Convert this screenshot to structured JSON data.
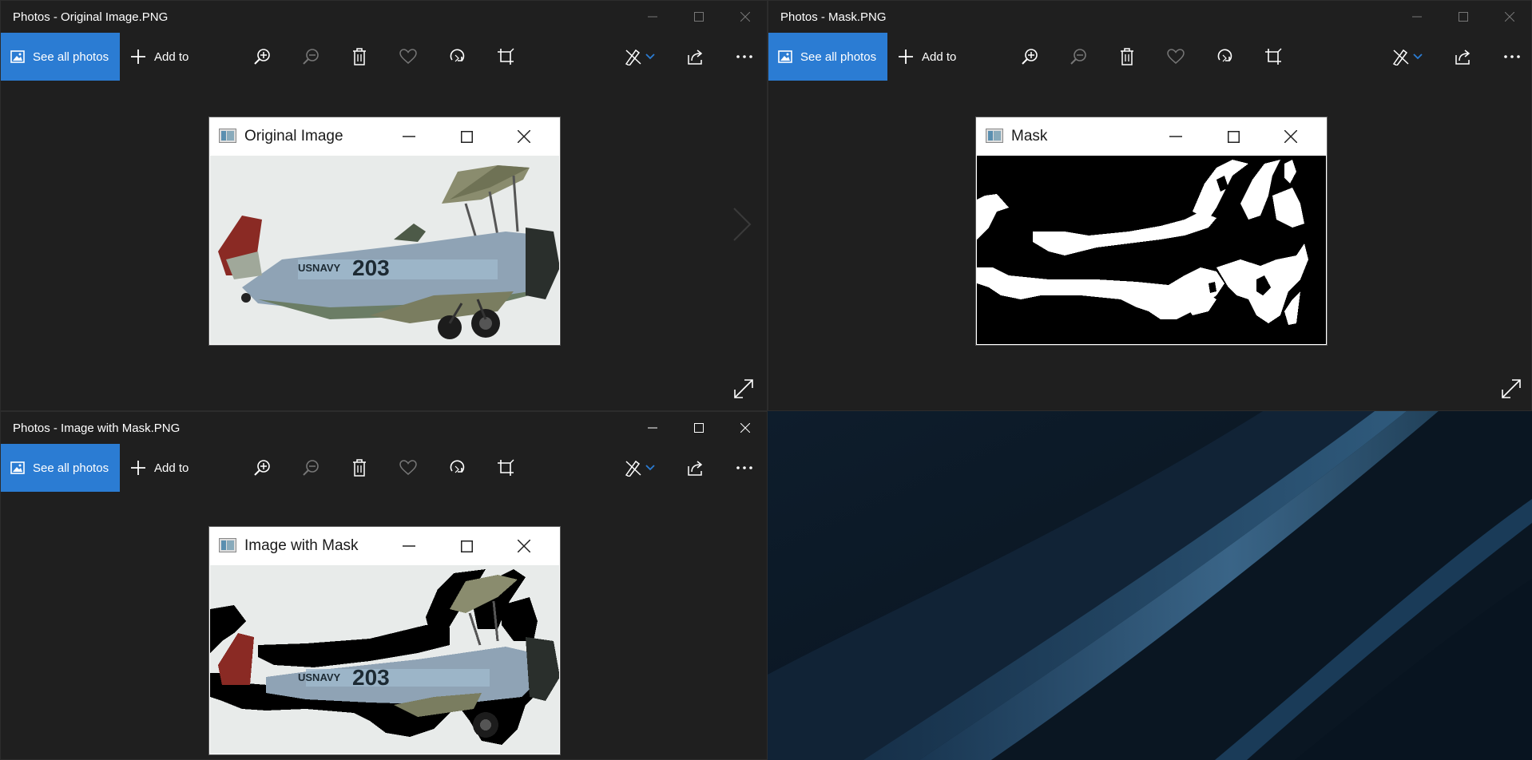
{
  "windows": {
    "original": {
      "title": "Photos - Original Image.PNG",
      "inner_title": "Original Image"
    },
    "mask": {
      "title": "Photos - Mask.PNG",
      "inner_title": "Mask"
    },
    "combined": {
      "title": "Photos - Image with Mask.PNG",
      "inner_title": "Image with Mask"
    }
  },
  "toolbar": {
    "see_all_label": "See all photos",
    "add_to_label": "Add to",
    "icons": [
      "zoom-in-icon",
      "zoom-out-icon",
      "delete-icon",
      "favorite-icon",
      "rotate-icon",
      "crop-icon",
      "edit-create-icon",
      "share-icon",
      "more-icon"
    ]
  },
  "airplane": {
    "tail_lettering": "USNAVY",
    "number": "203"
  },
  "colors": {
    "accent": "#2b7cd3",
    "window_bg": "#1f1f1f",
    "desktop": "#0d1b29"
  }
}
